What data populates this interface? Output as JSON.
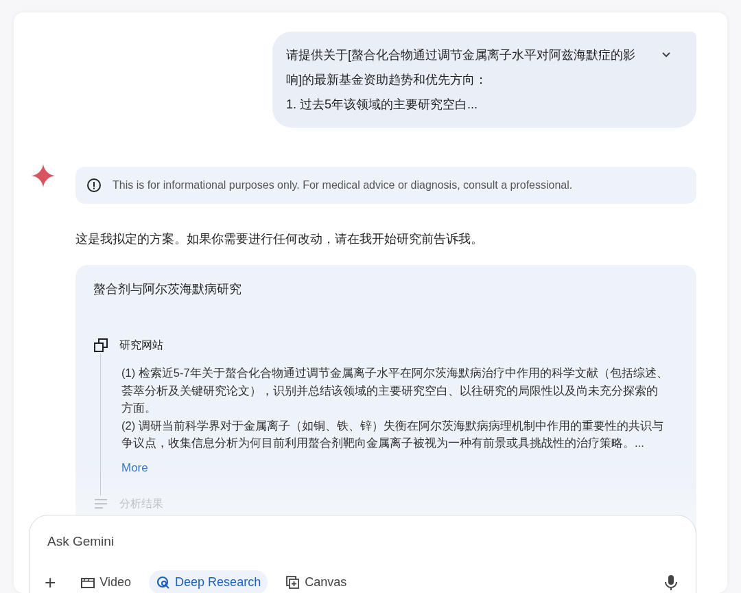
{
  "user_prompt": {
    "lines": [
      "请提供关于[螯合化合物通过调节金属离子水平对阿兹海默症的影响]的最新基金资助趋势和优先方向：",
      "1. 过去5年该领域的主要研究空白..."
    ],
    "expanded": false
  },
  "disclaimer": "This is for informational purposes only. For medical advice or diagnosis, consult a professional.",
  "reply_intro": "这是我拟定的方案。如果你需要进行任何改动，请在我开始研究前告诉我。",
  "plan": {
    "title": "螯合剂与阿尔茨海默病研究",
    "steps": [
      {
        "kind": "research",
        "label": "研究网站",
        "paragraphs": [
          "(1) 检索近5-7年关于螯合化合物通过调节金属离子水平在阿尔茨海默病治疗中作用的科学文献（包括综述、荟萃分析及关键研究论文），识别并总结该领域的主要研究空白、以往研究的局限性以及尚未充分探索的方面。",
          "(2) 调研当前科学界对于金属离子（如铜、铁、锌）失衡在阿尔茨海默病病理机制中作用的重要性的共识与争议点，收集信息分析为何目前利用螯合剂靶向金属离子被视为一种有前景或具挑战性的治疗策略。..."
        ],
        "more": "More"
      },
      {
        "kind": "analysis",
        "label": "分析结果"
      }
    ]
  },
  "composer": {
    "placeholder": "Ask Gemini",
    "tools": [
      {
        "kind": "add",
        "label": "+",
        "selected": false
      },
      {
        "kind": "video",
        "label": "Video",
        "selected": false
      },
      {
        "kind": "research",
        "label": "Deep Research",
        "selected": true
      },
      {
        "kind": "canvas",
        "label": "Canvas",
        "selected": false
      }
    ]
  }
}
